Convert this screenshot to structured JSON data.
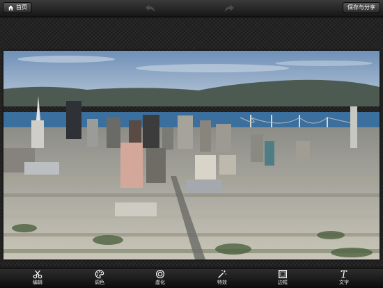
{
  "toolbar": {
    "home_label": "首页",
    "save_label": "保存与分享"
  },
  "tools": [
    {
      "label": "编辑",
      "icon": "scissors-icon"
    },
    {
      "label": "调色",
      "icon": "palette-icon"
    },
    {
      "label": "虚化",
      "icon": "focus-icon"
    },
    {
      "label": "特效",
      "icon": "magic-wand-icon"
    },
    {
      "label": "边框",
      "icon": "frame-icon"
    },
    {
      "label": "文字",
      "icon": "text-icon"
    }
  ],
  "photo": {
    "subject": "city skyline panorama"
  },
  "colors": {
    "toolbar": "#1f1f1f",
    "sky": "#8aa6c6",
    "water": "#3a6f9e"
  }
}
